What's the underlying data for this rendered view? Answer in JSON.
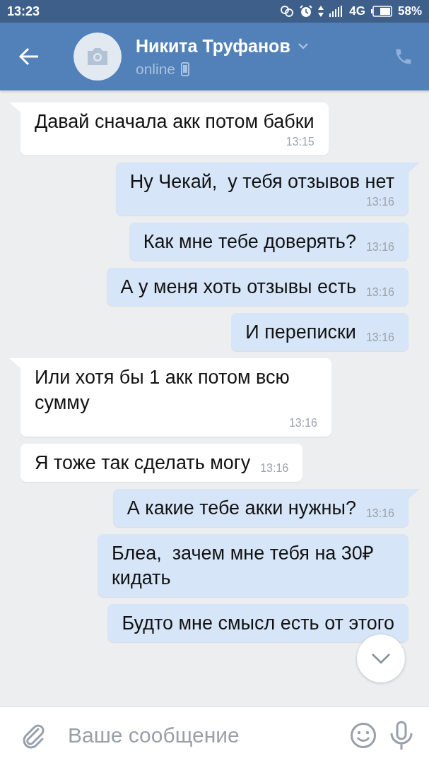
{
  "status_bar": {
    "time": "13:23",
    "network": "4G",
    "battery": "58%"
  },
  "header": {
    "name": "Никита Труфанов",
    "status": "online"
  },
  "messages": [
    {
      "kind": "in",
      "tail": true,
      "text": "Давай сначала акк потом бабки",
      "time": "13:15"
    },
    {
      "kind": "out",
      "tail": true,
      "text": "Ну Чекай,  у тебя отзывов нет",
      "time": "13:16"
    },
    {
      "kind": "out",
      "tail": false,
      "text": "Как мне тебе доверять?",
      "time": "13:16"
    },
    {
      "kind": "out",
      "tail": false,
      "text": "А у меня хоть отзывы есть",
      "time": "13:16"
    },
    {
      "kind": "out",
      "tail": false,
      "text": "И переписки",
      "time": "13:16"
    },
    {
      "kind": "in",
      "tail": true,
      "text": "Или хотя бы 1 акк потом всю сумму",
      "time": "13:16"
    },
    {
      "kind": "in",
      "tail": false,
      "text": "Я тоже так сделать могу",
      "time": "13:16"
    },
    {
      "kind": "out",
      "tail": true,
      "text": "А какие тебе акки нужны?",
      "time": "13:16"
    },
    {
      "kind": "out",
      "tail": false,
      "text": "Блеа,  зачем мне тебя на 30₽ кидать"
    },
    {
      "kind": "out",
      "tail": false,
      "text": "Будто мне смысл есть от этого"
    }
  ],
  "composer": {
    "placeholder": "Ваше сообщение"
  }
}
